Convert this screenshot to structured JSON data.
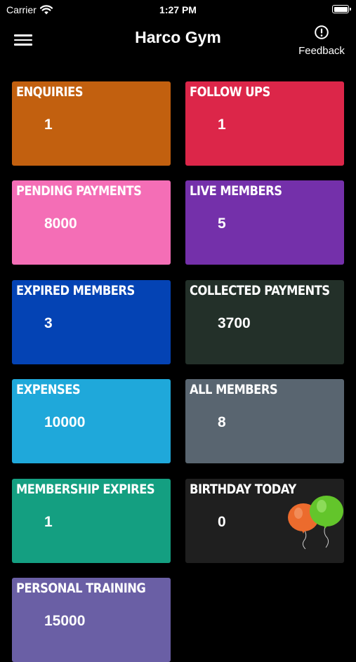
{
  "status": {
    "carrier": "Carrier",
    "time": "1:27 PM"
  },
  "nav": {
    "title": "Harco Gym",
    "feedback_label": "Feedback"
  },
  "tiles": [
    {
      "label": "ENQUIRIES",
      "value": "1",
      "color": "#c2600f"
    },
    {
      "label": "FOLLOW UPS",
      "value": "1",
      "color": "#dc2649"
    },
    {
      "label": "PENDING PAYMENTS",
      "value": "8000",
      "color": "#f46eb6"
    },
    {
      "label": "LIVE MEMBERS",
      "value": "5",
      "color": "#7430aa"
    },
    {
      "label": "EXPIRED MEMBERS",
      "value": "3",
      "color": "#0443b4"
    },
    {
      "label": "COLLECTED PAYMENTS",
      "value": "3700",
      "color": "#233029"
    },
    {
      "label": "EXPENSES",
      "value": "10000",
      "color": "#1fa8da"
    },
    {
      "label": "ALL MEMBERS",
      "value": "8",
      "color": "#596570"
    },
    {
      "label": "MEMBERSHIP EXPIRES",
      "value": "1",
      "color": "#149f81"
    },
    {
      "label": "BIRTHDAY TODAY",
      "value": "0",
      "color": "#1f1f1f"
    },
    {
      "label": "PERSONAL TRAINING",
      "value": "15000",
      "color": "#6a5fa5"
    }
  ],
  "icons": {
    "menu": "hamburger-icon",
    "feedback": "exclamation-circle-icon",
    "birthday": "balloons-icon",
    "wifi": "wifi-icon",
    "battery": "battery-icon"
  }
}
